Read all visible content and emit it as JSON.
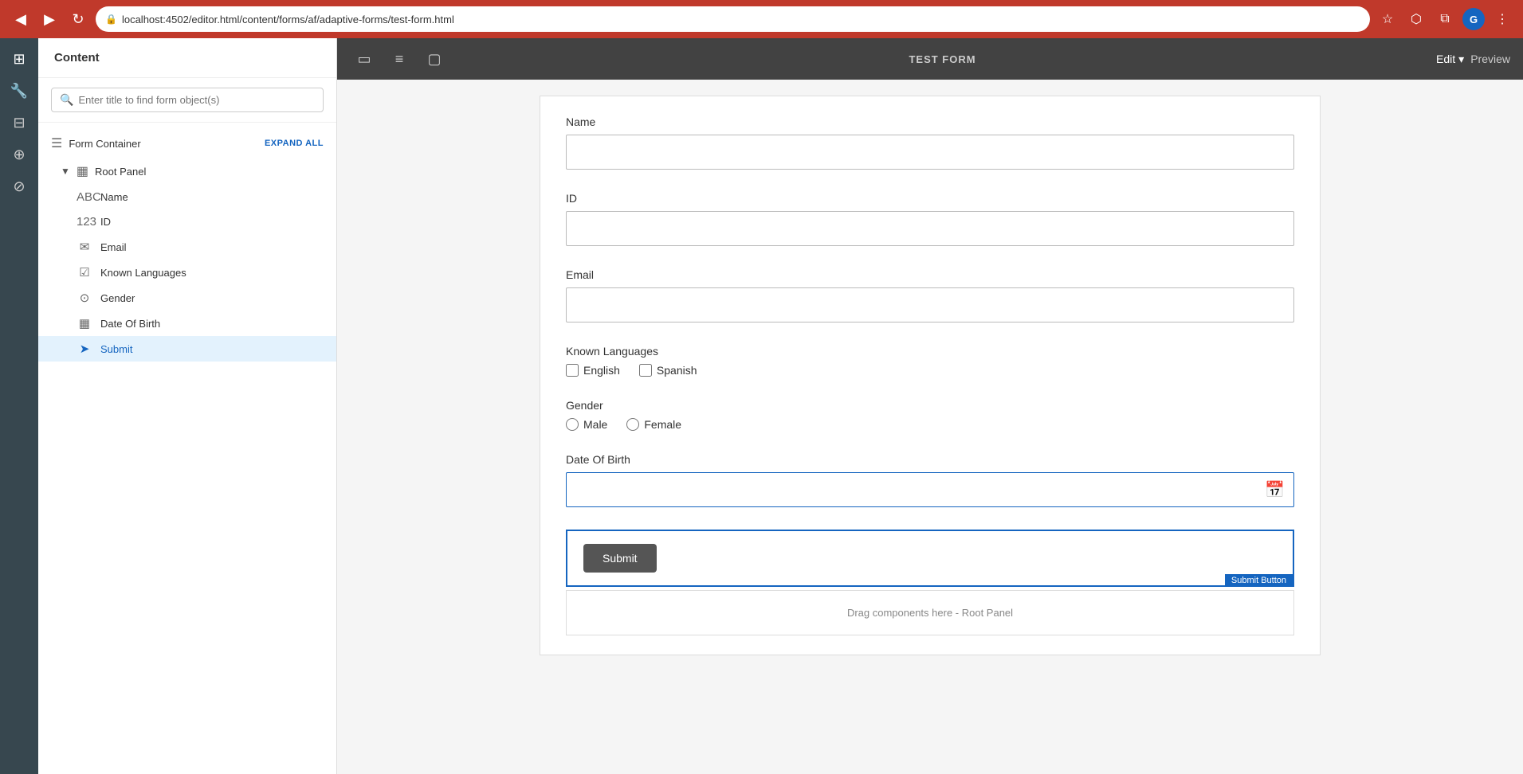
{
  "browser": {
    "url": "localhost:4502/editor.html/content/forms/af/adaptive-forms/test-form.html",
    "back_btn": "◀",
    "forward_btn": "▶",
    "reload_btn": "↻",
    "avatar_label": "G"
  },
  "rail": {
    "icons": [
      {
        "name": "layers-icon",
        "symbol": "⊞"
      },
      {
        "name": "wrench-icon",
        "symbol": "🔧"
      },
      {
        "name": "grid-icon",
        "symbol": "⊟"
      },
      {
        "name": "plus-square-icon",
        "symbol": "⊕"
      },
      {
        "name": "tag-icon",
        "symbol": "⊘"
      }
    ]
  },
  "sidebar": {
    "header": "Content",
    "search_placeholder": "Enter title to find form object(s)",
    "form_container_label": "Form Container",
    "expand_all_label": "EXPAND ALL",
    "root_panel_label": "Root Panel",
    "items": [
      {
        "id": "name",
        "label": "Name",
        "icon": "ABC"
      },
      {
        "id": "id",
        "label": "ID",
        "icon": "123"
      },
      {
        "id": "email",
        "label": "Email",
        "icon": "✉"
      },
      {
        "id": "known-languages",
        "label": "Known Languages",
        "icon": "☑"
      },
      {
        "id": "gender",
        "label": "Gender",
        "icon": "⊙"
      },
      {
        "id": "date-of-birth",
        "label": "Date Of Birth",
        "icon": "▦"
      },
      {
        "id": "submit",
        "label": "Submit",
        "icon": "➤",
        "active": true
      }
    ]
  },
  "toolbar": {
    "title": "TEST FORM",
    "edit_label": "Edit",
    "preview_label": "Preview",
    "icon1": "▭",
    "icon2": "≡",
    "icon3": "▢"
  },
  "form": {
    "fields": [
      {
        "id": "name",
        "label": "Name",
        "type": "text",
        "value": ""
      },
      {
        "id": "id",
        "label": "ID",
        "type": "text",
        "value": ""
      },
      {
        "id": "email",
        "label": "Email",
        "type": "text",
        "value": ""
      }
    ],
    "known_languages": {
      "label": "Known Languages",
      "options": [
        "English",
        "Spanish"
      ]
    },
    "gender": {
      "label": "Gender",
      "options": [
        "Male",
        "Female"
      ]
    },
    "date_of_birth": {
      "label": "Date Of Birth"
    },
    "submit_label": "Submit",
    "submit_badge": "Submit Button",
    "drag_zone": "Drag components here - Root Panel"
  }
}
